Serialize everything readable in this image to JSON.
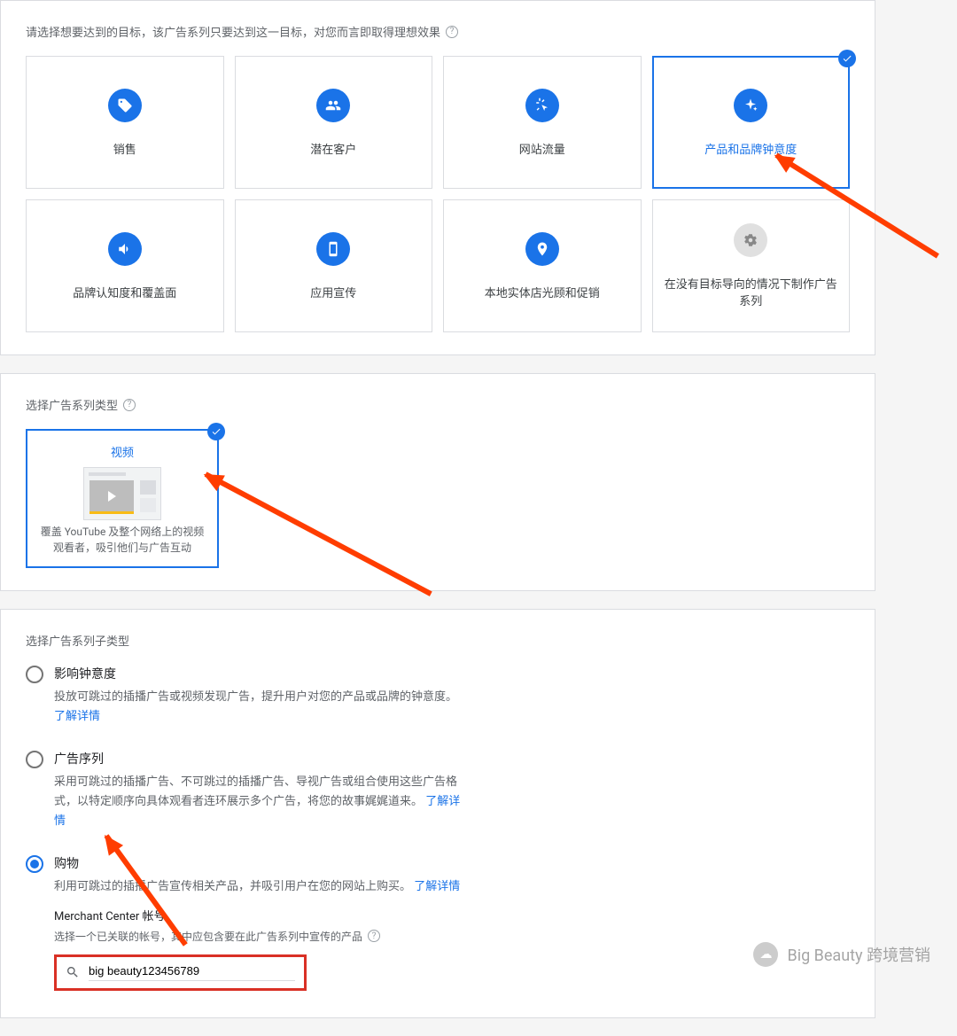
{
  "goalSection": {
    "label": "请选择想要达到的目标，该广告系列只要达到这一目标，对您而言即取得理想效果",
    "goals": [
      {
        "label": "销售"
      },
      {
        "label": "潜在客户"
      },
      {
        "label": "网站流量"
      },
      {
        "label": "产品和品牌钟意度"
      },
      {
        "label": "品牌认知度和覆盖面"
      },
      {
        "label": "应用宣传"
      },
      {
        "label": "本地实体店光顾和促销"
      },
      {
        "label": "在没有目标导向的情况下制作广告系列"
      }
    ]
  },
  "typeSection": {
    "label": "选择广告系列类型",
    "card": {
      "title": "视频",
      "desc": "覆盖 YouTube 及整个网络上的视频观看者，吸引他们与广告互动"
    }
  },
  "subtypeSection": {
    "label": "选择广告系列子类型",
    "options": [
      {
        "title": "影响钟意度",
        "desc": "投放可跳过的插播广告或视频发现广告，提升用户对您的产品或品牌的钟意度。",
        "link": "了解详情"
      },
      {
        "title": "广告序列",
        "desc": "采用可跳过的插播广告、不可跳过的插播广告、导视广告或组合使用这些广告格式，以特定顺序向具体观看者连环展示多个广告，将您的故事娓娓道来。",
        "link": "了解详情"
      },
      {
        "title": "购物",
        "desc": "利用可跳过的插播广告宣传相关产品，并吸引用户在您的网站上购买。",
        "link": "了解详情"
      }
    ],
    "merchant": {
      "title": "Merchant Center 帐号",
      "hint": "选择一个已关联的帐号，其中应包含要在此广告系列中宣传的产品",
      "value": "big beauty123456789"
    }
  },
  "watermark": "Big Beauty 跨境营销"
}
